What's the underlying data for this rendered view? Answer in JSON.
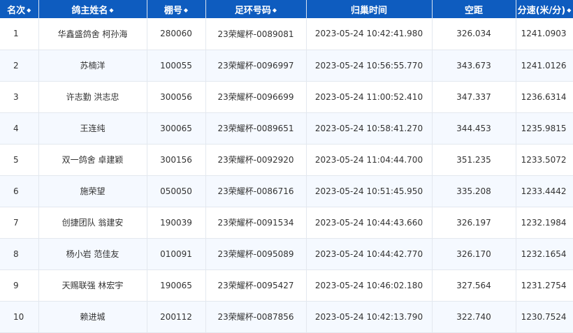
{
  "headers": {
    "rank": "名次",
    "owner": "鸽主姓名",
    "pen": "棚号",
    "ring": "足环号码",
    "time": "归巢时间",
    "distance": "空距",
    "speed": "分速(米/分)"
  },
  "sort_icon": "◆",
  "rows": [
    {
      "rank": "1",
      "owner": "华鑫盛鸽舍 柯孙海",
      "pen": "280060",
      "ring": "23荣耀杯-0089081",
      "time": "2023-05-24 10:42:41.980",
      "distance": "326.034",
      "speed": "1241.0903"
    },
    {
      "rank": "2",
      "owner": "苏楠洋",
      "pen": "100055",
      "ring": "23荣耀杯-0096997",
      "time": "2023-05-24 10:56:55.770",
      "distance": "343.673",
      "speed": "1241.0126"
    },
    {
      "rank": "3",
      "owner": "许志勤 洪志忠",
      "pen": "300056",
      "ring": "23荣耀杯-0096699",
      "time": "2023-05-24 11:00:52.410",
      "distance": "347.337",
      "speed": "1236.6314"
    },
    {
      "rank": "4",
      "owner": "王连纯",
      "pen": "300065",
      "ring": "23荣耀杯-0089651",
      "time": "2023-05-24 10:58:41.270",
      "distance": "344.453",
      "speed": "1235.9815"
    },
    {
      "rank": "5",
      "owner": "双一鸽舍 卓建颖",
      "pen": "300156",
      "ring": "23荣耀杯-0092920",
      "time": "2023-05-24 11:04:44.700",
      "distance": "351.235",
      "speed": "1233.5072"
    },
    {
      "rank": "6",
      "owner": "施荣望",
      "pen": "050050",
      "ring": "23荣耀杯-0086716",
      "time": "2023-05-24 10:51:45.950",
      "distance": "335.208",
      "speed": "1233.4442"
    },
    {
      "rank": "7",
      "owner": "创捷团队 翁建安",
      "pen": "190039",
      "ring": "23荣耀杯-0091534",
      "time": "2023-05-24 10:44:43.660",
      "distance": "326.197",
      "speed": "1232.1984"
    },
    {
      "rank": "8",
      "owner": "杨小岩 范佳友",
      "pen": "010091",
      "ring": "23荣耀杯-0095089",
      "time": "2023-05-24 10:44:42.770",
      "distance": "326.170",
      "speed": "1232.1654"
    },
    {
      "rank": "9",
      "owner": "天赐联强 林宏宇",
      "pen": "190065",
      "ring": "23荣耀杯-0095427",
      "time": "2023-05-24 10:46:02.180",
      "distance": "327.564",
      "speed": "1231.2754"
    },
    {
      "rank": "10",
      "owner": "赖进城",
      "pen": "200112",
      "ring": "23荣耀杯-0087856",
      "time": "2023-05-24 10:42:13.790",
      "distance": "322.740",
      "speed": "1230.7524"
    }
  ]
}
